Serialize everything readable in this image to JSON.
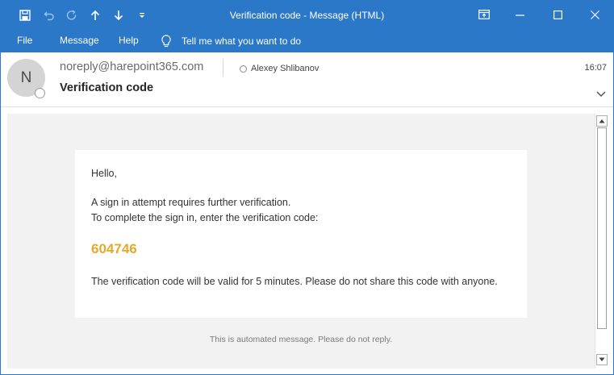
{
  "window": {
    "title": "Verification code  -  Message (HTML)"
  },
  "ribbon": {
    "tabs": [
      "File",
      "Message",
      "Help"
    ],
    "tell_me": "Tell me what you want to do"
  },
  "message": {
    "avatar_initial": "N",
    "sender": "noreply@harepoint365.com",
    "recipient": "Alexey Shlibanov",
    "subject": "Verification code",
    "time": "16:07",
    "body": {
      "greeting": "Hello,",
      "line1": "A sign in attempt requires further verification.",
      "line2": "To complete the sign in, enter the verification code:",
      "code": "604746",
      "validity": "The verification code will be valid for 5 minutes. Please do not share this code with anyone.",
      "footer": "This is automated message. Please do not reply."
    }
  },
  "colors": {
    "accent": "#2b78c8",
    "code": "#e3a82d",
    "body_background": "#f2f2f2"
  }
}
